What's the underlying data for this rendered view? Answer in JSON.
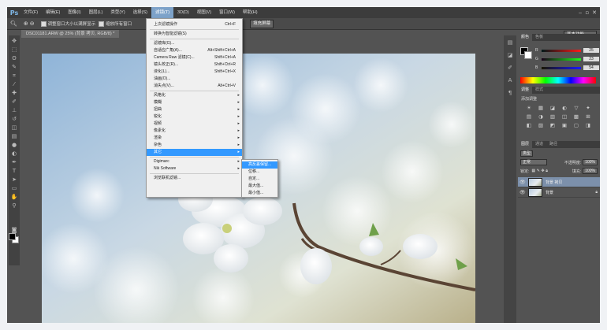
{
  "app": {
    "logo": "Ps"
  },
  "menubar": {
    "items": [
      {
        "label": "文件(F)"
      },
      {
        "label": "编辑(E)"
      },
      {
        "label": "图像(I)"
      },
      {
        "label": "图层(L)"
      },
      {
        "label": "类型(Y)"
      },
      {
        "label": "选择(S)"
      },
      {
        "label": "滤镜(T)"
      },
      {
        "label": "3D(D)"
      },
      {
        "label": "视图(V)"
      },
      {
        "label": "窗口(W)"
      },
      {
        "label": "帮助(H)"
      }
    ],
    "active_index": 6,
    "window_controls": [
      "‒",
      "▫",
      "✕"
    ]
  },
  "options": {
    "zoom_icon": "zoom-icon",
    "resize_windows": "调整窗口大小以满屏显示",
    "zoom_all": "缩放所有窗口",
    "fill_screen": "填充屏幕",
    "workspace": "基本功能"
  },
  "document": {
    "tab": "DSC01181.ARW @ 25% (背景 拷贝, RGB/8) *"
  },
  "filter_menu": {
    "items": [
      {
        "label": "上次滤镜操作",
        "shortcut": "Ctrl+F",
        "disabled": false
      },
      {
        "sep": true
      },
      {
        "label": "转换为智能滤镜(S)"
      },
      {
        "sep": true
      },
      {
        "label": "滤镜库(G)..."
      },
      {
        "label": "自适应广角(A)...",
        "shortcut": "Alt+Shift+Ctrl+A"
      },
      {
        "label": "Camera Raw 滤镜(C)...",
        "shortcut": "Shift+Ctrl+A"
      },
      {
        "label": "镜头校正(R)...",
        "shortcut": "Shift+Ctrl+R"
      },
      {
        "label": "液化(L)...",
        "shortcut": "Shift+Ctrl+X"
      },
      {
        "label": "油画(O)..."
      },
      {
        "label": "消失点(V)...",
        "shortcut": "Alt+Ctrl+V"
      },
      {
        "sep": true
      },
      {
        "label": "风格化",
        "sub": true
      },
      {
        "label": "模糊",
        "sub": true
      },
      {
        "label": "扭曲",
        "sub": true
      },
      {
        "label": "锐化",
        "sub": true
      },
      {
        "label": "视频",
        "sub": true
      },
      {
        "label": "像素化",
        "sub": true
      },
      {
        "label": "渲染",
        "sub": true
      },
      {
        "label": "杂色",
        "sub": true
      },
      {
        "label": "其它",
        "sub": true,
        "highlighted": true
      },
      {
        "sep": true
      },
      {
        "label": "Digimarc",
        "sub": true
      },
      {
        "label": "Nik Software",
        "sub": true
      },
      {
        "sep": true
      },
      {
        "label": "浏览联机滤镜..."
      }
    ]
  },
  "other_submenu": {
    "items": [
      {
        "label": "高反差保留...",
        "highlighted": true
      },
      {
        "label": "位移..."
      },
      {
        "label": "自定..."
      },
      {
        "label": "最大值..."
      },
      {
        "label": "最小值..."
      }
    ]
  },
  "panels": {
    "color_tabs": [
      "颜色",
      "色板"
    ],
    "color": {
      "rows": [
        {
          "label": "R",
          "value": "25",
          "from": "#001919",
          "to": "#ff1919"
        },
        {
          "label": "G",
          "value": "23",
          "from": "#190019",
          "to": "#19ff19"
        },
        {
          "label": "B",
          "value": "54",
          "from": "#191700",
          "to": "#1917ff"
        }
      ]
    },
    "adj_tabs": [
      "调整",
      "样式"
    ],
    "adjustments": {
      "title": "添加调整",
      "icons": [
        "☀",
        "▦",
        "◪",
        "◐",
        "▽",
        "✦",
        "▤",
        "◑",
        "▥",
        "◫",
        "▩",
        "⊞",
        "◧",
        "▨",
        "◩",
        "▣",
        "▢",
        "◨"
      ]
    },
    "layers_tabs": [
      "图层",
      "通道",
      "路径"
    ],
    "layers": {
      "kind": "类型",
      "blend_mode": "正常",
      "opacity_label": "不透明度:",
      "opacity": "100%",
      "lock_label": "锁定:",
      "fill_label": "填充:",
      "fill": "100%",
      "items": [
        {
          "name": "背景 拷贝",
          "selected": true
        },
        {
          "name": "背景",
          "selected": false
        }
      ]
    }
  },
  "colors": {
    "accent": "#3399ff",
    "menubar": "#3c3c3c",
    "bg": "#535353"
  }
}
